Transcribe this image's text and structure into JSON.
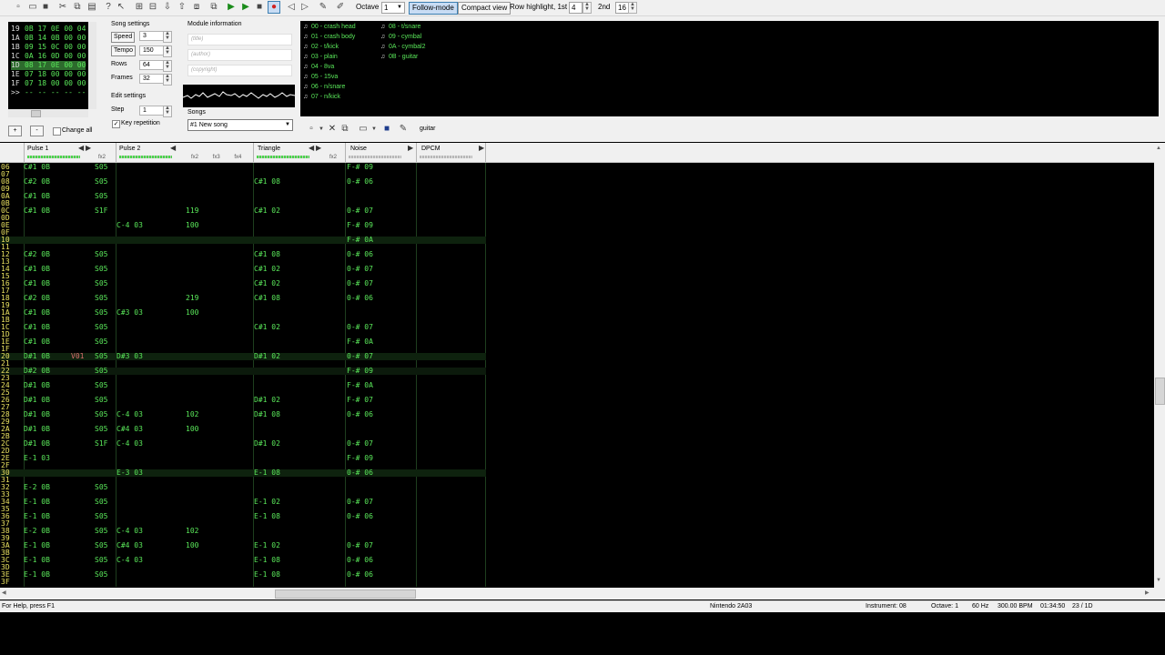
{
  "toolbar": {
    "octave_label": "Octave",
    "octave_value": "1",
    "follow_mode_label": "Follow-mode",
    "compact_view_label": "Compact view",
    "row_highlight_label": "Row highlight, 1st",
    "row_highlight_1st": "4",
    "row_highlight_2nd_label": "2nd",
    "row_highlight_2nd": "16",
    "icons": [
      "new-file-icon",
      "open-file-icon",
      "save-icon",
      "cut-icon",
      "copy-icon",
      "paste-icon",
      "help-icon",
      "cursor-help-icon",
      "insert-frame-icon",
      "remove-frame-icon",
      "move-frame-down-icon",
      "move-frame-up-icon",
      "duplicate-frame-icon",
      "clone-patterns-icon",
      "play-icon",
      "play-pattern-icon",
      "stop-icon",
      "record-icon",
      "previous-track-icon",
      "next-track-icon",
      "settings-icon",
      "edit-icon"
    ]
  },
  "frame_list": {
    "rows": [
      {
        "num": "19",
        "vals": "0B 17 0E 00 04"
      },
      {
        "num": "1A",
        "vals": "0B 14 0B 00 00"
      },
      {
        "num": "1B",
        "vals": "09 15 0C 00 00"
      },
      {
        "num": "1C",
        "vals": "0A 16 0D 00 00"
      },
      {
        "num": "1D",
        "vals": "08 17 0E 00 00"
      },
      {
        "num": "1E",
        "vals": "07 18 00 00 00"
      },
      {
        "num": "1F",
        "vals": "07 18 00 00 00"
      },
      {
        "num": ">>",
        "vals": "-- -- -- -- --"
      }
    ],
    "add_label": "+",
    "remove_label": "-",
    "change_all_label": "Change all"
  },
  "song_settings": {
    "title": "Song settings",
    "speed_label": "Speed",
    "speed_value": "3",
    "tempo_label": "Tempo",
    "tempo_value": "150",
    "rows_label": "Rows",
    "rows_value": "64",
    "frames_label": "Frames",
    "frames_value": "32"
  },
  "edit_settings": {
    "title": "Edit settings",
    "step_label": "Step",
    "step_value": "1",
    "key_repetition_label": "Key repetition"
  },
  "module_info": {
    "title": "Module information",
    "title_placeholder": "(title)",
    "author_placeholder": "(author)",
    "copyright_placeholder": "(copyright)"
  },
  "songs": {
    "label": "Songs",
    "selected": "#1 New song"
  },
  "instruments": [
    {
      "id": "00",
      "name": "crash head"
    },
    {
      "id": "01",
      "name": "crash body"
    },
    {
      "id": "02",
      "name": "t/kick"
    },
    {
      "id": "03",
      "name": "plain"
    },
    {
      "id": "04",
      "name": "8va"
    },
    {
      "id": "05",
      "name": "15va"
    },
    {
      "id": "06",
      "name": "n/snare"
    },
    {
      "id": "07",
      "name": "n/kick"
    },
    {
      "id": "08",
      "name": "t/snare"
    },
    {
      "id": "09",
      "name": "cymbal"
    },
    {
      "id": "0A",
      "name": "cymbal2"
    },
    {
      "id": "0B",
      "name": "guitar"
    }
  ],
  "instrument_name_value": "guitar",
  "channels": [
    {
      "name": "Pulse 1",
      "fx": "fx2"
    },
    {
      "name": "Pulse 2",
      "fx": "fx2 fx3 fx4"
    },
    {
      "name": "Triangle",
      "fx": "fx2"
    },
    {
      "name": "Noise",
      "fx": ""
    },
    {
      "name": "DPCM",
      "fx": ""
    }
  ],
  "pattern_rows": [
    {
      "r": "06",
      "p1": "C#1 0B",
      "e1": "S05",
      "n": "F-# 09"
    },
    {
      "r": "07"
    },
    {
      "r": "08",
      "p1": "C#2 0B",
      "e1": "S05",
      "t": "C#1 08",
      "n": "0-# 06"
    },
    {
      "r": "09"
    },
    {
      "r": "0A",
      "p1": "C#1 0B",
      "e1": "S05"
    },
    {
      "r": "0B"
    },
    {
      "r": "0C",
      "p1": "C#1 0B",
      "e1": "S1F",
      "p2v": "119",
      "t": "C#1 02",
      "n": "0-# 07"
    },
    {
      "r": "0D"
    },
    {
      "r": "0E",
      "p2": "C-4 03",
      "p2v": "100",
      "n": "F-# 09"
    },
    {
      "r": "0F"
    },
    {
      "r": "10",
      "n": "F-# 0A",
      "big": true
    },
    {
      "r": "11"
    },
    {
      "r": "12",
      "p1": "C#2 0B",
      "e1": "S05",
      "t": "C#1 08",
      "n": "0-# 06"
    },
    {
      "r": "13"
    },
    {
      "r": "14",
      "p1": "C#1 0B",
      "e1": "S05",
      "t": "C#1 02",
      "n": "0-# 07"
    },
    {
      "r": "15"
    },
    {
      "r": "16",
      "p1": "C#1 0B",
      "e1": "S05",
      "t": "C#1 02",
      "n": "0-# 07"
    },
    {
      "r": "17"
    },
    {
      "r": "18",
      "p1": "C#2 0B",
      "e1": "S05",
      "p2v": "219",
      "t": "C#1 08",
      "n": "0-# 06"
    },
    {
      "r": "19"
    },
    {
      "r": "1A",
      "p1": "C#1 0B",
      "e1": "S05",
      "p2": "C#3 03",
      "p2v": "100"
    },
    {
      "r": "1B"
    },
    {
      "r": "1C",
      "p1": "C#1 0B",
      "e1": "S05",
      "t": "C#1 02",
      "n": "0-# 07"
    },
    {
      "r": "1D"
    },
    {
      "r": "1E",
      "p1": "C#1 0B",
      "e1": "S05",
      "n": "F-# 0A"
    },
    {
      "r": "1F"
    },
    {
      "r": "20",
      "p1": "D#1 0B",
      "v1": "V01",
      "e1": "S05",
      "p2": "D#3 03",
      "t": "D#1 02",
      "n": "0-# 07",
      "big": true
    },
    {
      "r": "21"
    },
    {
      "r": "22",
      "p1": "D#2 0B",
      "e1": "S05",
      "n": "F-# 09",
      "cur": true
    },
    {
      "r": "23"
    },
    {
      "r": "24",
      "p1": "D#1 0B",
      "e1": "S05",
      "n": "F-# 0A"
    },
    {
      "r": "25"
    },
    {
      "r": "26",
      "p1": "D#1 0B",
      "e1": "S05",
      "t": "D#1 02",
      "n": "F-# 07"
    },
    {
      "r": "27"
    },
    {
      "r": "28",
      "p1": "D#1 0B",
      "e1": "S05",
      "p2": "C-4 03",
      "p2v": "102",
      "t": "D#1 08",
      "n": "0-# 06"
    },
    {
      "r": "29"
    },
    {
      "r": "2A",
      "p1": "D#1 0B",
      "e1": "S05",
      "p2": "C#4 03",
      "p2v": "100"
    },
    {
      "r": "2B"
    },
    {
      "r": "2C",
      "p1": "D#1 0B",
      "e1": "S1F",
      "p2": "C-4 03",
      "t": "D#1 02",
      "n": "0-# 07"
    },
    {
      "r": "2D"
    },
    {
      "r": "2E",
      "p1": "E-1 03",
      "n": "F-# 09"
    },
    {
      "r": "2F"
    },
    {
      "r": "30",
      "p2": "E-3 03",
      "t": "E-1 08",
      "n": "0-# 06",
      "big": true
    },
    {
      "r": "31"
    },
    {
      "r": "32",
      "p1": "E-2 0B",
      "e1": "S05"
    },
    {
      "r": "33"
    },
    {
      "r": "34",
      "p1": "E-1 0B",
      "e1": "S05",
      "t": "E-1 02",
      "n": "0-# 07"
    },
    {
      "r": "35"
    },
    {
      "r": "36",
      "p1": "E-1 0B",
      "e1": "S05",
      "t": "E-1 08",
      "n": "0-# 06"
    },
    {
      "r": "37"
    },
    {
      "r": "38",
      "p1": "E-2 0B",
      "e1": "S05",
      "p2": "C-4 03",
      "p2v": "102"
    },
    {
      "r": "39"
    },
    {
      "r": "3A",
      "p1": "E-1 0B",
      "e1": "S05",
      "p2": "C#4 03",
      "p2v": "100",
      "t": "E-1 02",
      "n": "0-# 07"
    },
    {
      "r": "3B"
    },
    {
      "r": "3C",
      "p1": "E-1 0B",
      "e1": "S05",
      "p2": "C-4 03",
      "t": "E-1 08",
      "n": "0-# 06"
    },
    {
      "r": "3D"
    },
    {
      "r": "3E",
      "p1": "E-1 0B",
      "e1": "S05",
      "t": "E-1 08",
      "n": "0-# 06"
    },
    {
      "r": "3F"
    }
  ],
  "status_bar": {
    "help": "For Help, press F1",
    "chip": "Nintendo 2A03",
    "instrument": "Instrument: 08",
    "octave": "Octave: 1",
    "rate": "60 Hz",
    "bpm": "300.00 BPM",
    "time": "01:34:50",
    "position": "23 / 1D"
  },
  "colors": {
    "pattern_bg": "#000000",
    "note_green": "#5ae85a",
    "row_number_yellow": "#e8e060",
    "toolbar_bg": "#f0f0f0"
  }
}
